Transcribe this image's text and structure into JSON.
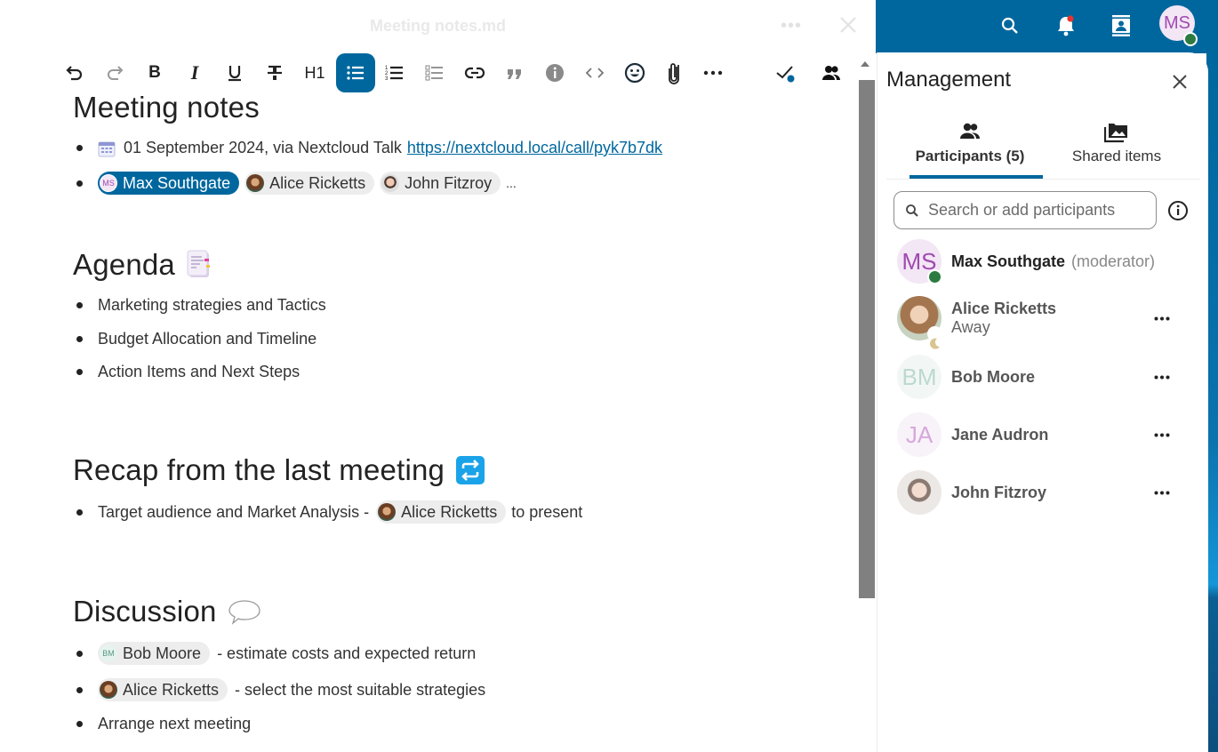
{
  "editor": {
    "file_title": "Meeting notes.md",
    "toolbar": {
      "heading_label": "H1",
      "items": [
        "undo",
        "redo",
        "bold",
        "italic",
        "underline",
        "strikethrough",
        "heading",
        "bullet-list",
        "numbered-list",
        "task-list",
        "link",
        "blockquote",
        "callout",
        "code",
        "emoji",
        "attachment",
        "more"
      ],
      "active": "bullet-list",
      "accent": "#00679e"
    },
    "doc": {
      "title": "Meeting notes",
      "meta_date": "01 September 2024, via Nextcloud Talk",
      "meta_link": "https://nextcloud.local/call/pyk7b7dk",
      "attendees": [
        {
          "name": "Max Southgate",
          "initials": "MS",
          "self": true
        },
        {
          "name": "Alice Ricketts"
        },
        {
          "name": "John Fitzroy"
        }
      ],
      "attendees_more": "...",
      "agenda_heading": "Agenda",
      "agenda_items": [
        "Marketing strategies and Tactics",
        "Budget Allocation and Timeline",
        "Action Items and Next Steps"
      ],
      "recap_heading": "Recap from the last meeting",
      "recap_item": {
        "before": "Target audience and Market Analysis -",
        "mention": "Alice Ricketts",
        "after": "to present"
      },
      "discussion_heading": "Discussion",
      "discussion_items": [
        {
          "mention": "Bob Moore",
          "initials": "BM",
          "text": "- estimate costs and expected return"
        },
        {
          "mention": "Alice Ricketts",
          "text": "- select the most suitable strategies"
        },
        {
          "text": "Arrange next meeting"
        }
      ]
    }
  },
  "header": {
    "user_initials": "MS",
    "status_color": "#2d7b41",
    "notification_dot_color": "#e9322d"
  },
  "panel": {
    "title": "Management",
    "tabs": [
      {
        "label": "Participants (5)",
        "selected": true
      },
      {
        "label": "Shared items",
        "selected": false
      }
    ],
    "search_placeholder": "Search or add participants",
    "participants": [
      {
        "name": "Max Southgate",
        "initials": "MS",
        "role": "(moderator)",
        "status": "online"
      },
      {
        "name": "Alice Ricketts",
        "status_text": "Away",
        "status": "away"
      },
      {
        "name": "Bob Moore",
        "initials": "BM"
      },
      {
        "name": "Jane Audron",
        "initials": "JA"
      },
      {
        "name": "John Fitzroy"
      }
    ]
  }
}
